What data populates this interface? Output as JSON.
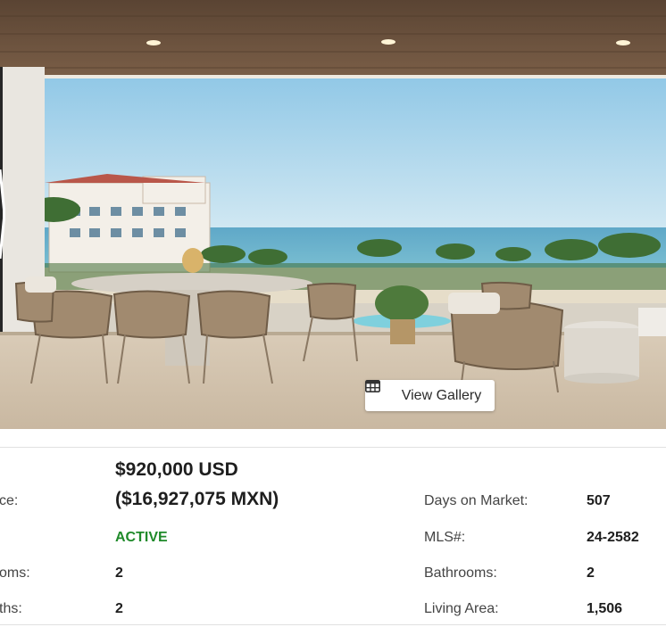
{
  "gallery": {
    "button_label": "View Gallery",
    "icon": "table-grid-icon"
  },
  "listing": {
    "price_usd": "$920,000 USD",
    "price_mxn": "($16,927,075 MXN)",
    "left_labels": {
      "price": "ce:",
      "bedrooms": "oms:",
      "baths": "ths:"
    },
    "status": "ACTIVE",
    "bedrooms": "2",
    "half_baths": "2",
    "right": {
      "days_on_market_label": "Days on Market:",
      "days_on_market": "507",
      "mls_label": "MLS#:",
      "mls": "24-2582",
      "bathrooms_label": "Bathrooms:",
      "bathrooms": "2",
      "living_area_label": "Living Area:",
      "living_area": "1,506"
    }
  },
  "colors": {
    "status_active": "#1f8a2a"
  }
}
